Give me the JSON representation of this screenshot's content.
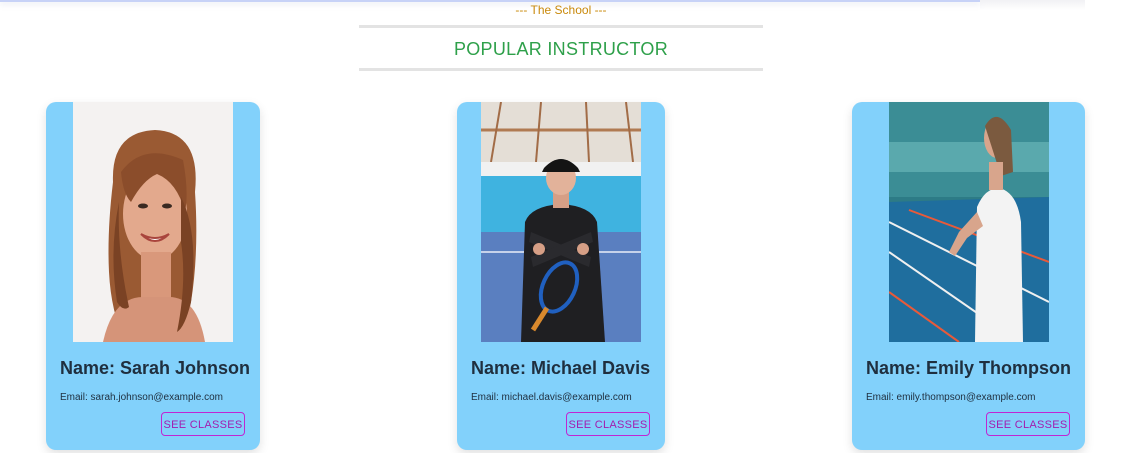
{
  "section": {
    "subheading": "--- The School ---",
    "heading": "POPULAR INSTRUCTOR"
  },
  "instructors": [
    {
      "name": "Name: Sarah Johnson",
      "email": "Email: sarah.johnson@example.com",
      "button_label": "SEE CLASSES"
    },
    {
      "name": "Name: Michael Davis",
      "email": "Email: michael.davis@example.com",
      "button_label": "SEE CLASSES"
    },
    {
      "name": "Name: Emily Thompson",
      "email": "Email: emily.thompson@example.com",
      "button_label": "SEE CLASSES"
    }
  ],
  "colors": {
    "card_background": "#82d1fb",
    "heading": "#2ea04a",
    "subheading": "#c9890a",
    "button_border": "#c026d3"
  }
}
